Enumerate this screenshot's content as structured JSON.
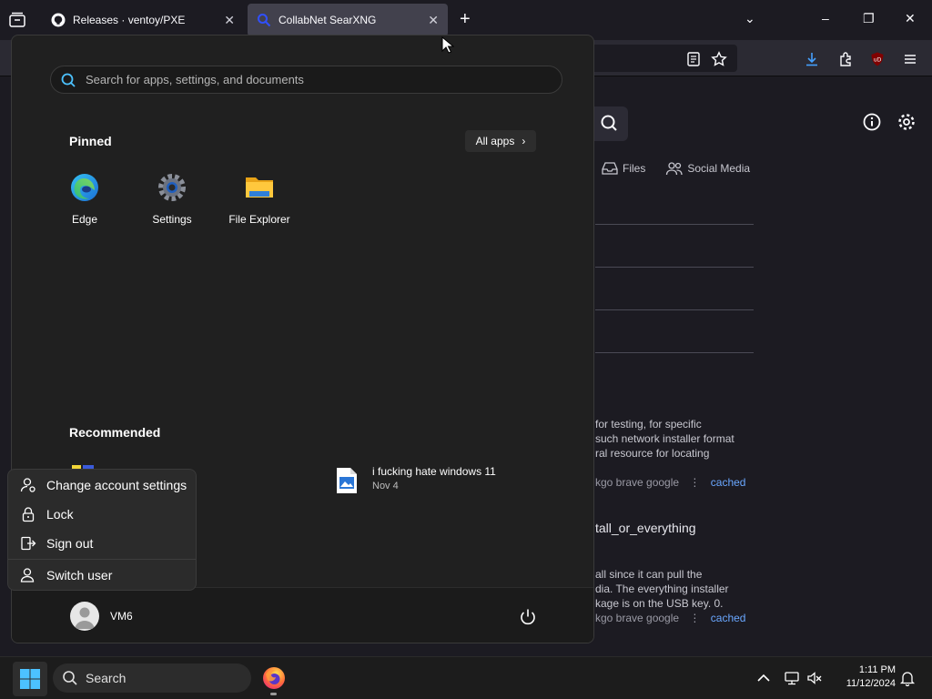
{
  "browser": {
    "tabs": [
      {
        "title": "Releases · ventoy/PXE",
        "active": false
      },
      {
        "title": "CollabNet SearXNG",
        "active": true
      }
    ],
    "colors": {
      "tab_active": "#42414d",
      "accent": "#6aa7ff"
    }
  },
  "page": {
    "categories": [
      "Files",
      "Social Media"
    ],
    "results": [
      {
        "snippet_lines": [
          "for testing, for specific",
          "such network installer format",
          "ral resource for locating"
        ],
        "engines": "kgo  brave  google",
        "cached": "cached"
      },
      {
        "title": "tall_or_everything",
        "snippet_lines": [
          "all since it can pull the",
          "dia. The everything installer",
          "kage is on the USB key. 0."
        ],
        "engines": "kgo  brave  google",
        "cached": "cached"
      }
    ]
  },
  "start_menu": {
    "search_placeholder": "Search for apps, settings, and documents",
    "pinned_title": "Pinned",
    "all_apps_label": "All apps",
    "pinned_apps": [
      {
        "label": "Edge",
        "icon": "edge-icon"
      },
      {
        "label": "Settings",
        "icon": "settings-gear-icon"
      },
      {
        "label": "File Explorer",
        "icon": "folder-icon"
      }
    ],
    "recommended_title": "Recommended",
    "recommended": [
      {
        "name": "i fucking hate windows 11",
        "date": "Nov 4",
        "icon": "image-file-icon"
      }
    ],
    "account_menu": [
      {
        "label": "Change account settings",
        "icon": "account-settings-icon"
      },
      {
        "label": "Lock",
        "icon": "lock-icon"
      },
      {
        "label": "Sign out",
        "icon": "sign-out-icon"
      },
      {
        "label": "Switch user",
        "icon": "switch-user-icon"
      }
    ],
    "user_name": "VM6"
  },
  "taskbar": {
    "search_label": "Search",
    "time": "1:11 PM",
    "date": "11/12/2024"
  }
}
